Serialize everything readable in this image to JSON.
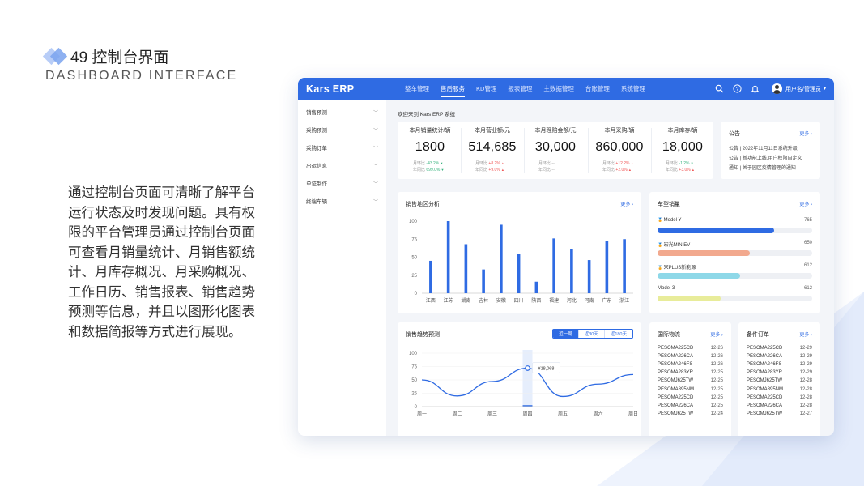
{
  "slide": {
    "title": "49 控制台界面",
    "subtitle": "DASHBOARD INTERFACE",
    "description": "通过控制台页面可清晰了解平台运行状态及时发现问题。具有权限的平台管理员通过控制台页面可查看月销量统计、月销售额统计、月库存概况、月采购概况、工作日历、销售报表、销售趋势预测等信息，并且以图形化图表和数据简报等方式进行展现。"
  },
  "app": {
    "logo": "Kars ERP",
    "nav": [
      "整车管理",
      "售后服务",
      "KD管理",
      "报表管理",
      "主数据管理",
      "台账管理",
      "系统管理"
    ],
    "nav_active": 1,
    "user": "用户名/管理员",
    "sidebar": [
      "销售预测",
      "采购预测",
      "采购订单",
      "出运信息",
      "单证制作",
      "终端车辆"
    ],
    "welcome": "欢迎来到 Kars ERP 系统",
    "stats": [
      {
        "label": "本月销量统计/辆",
        "value": "1800",
        "mom_label": "月环比",
        "mom": "-43.2%",
        "mom_dir": "down",
        "yoy_label": "年同比",
        "yoy": "699.0%",
        "yoy_dir": "down"
      },
      {
        "label": "本月营业额/元",
        "value": "514,685",
        "mom_label": "月环比",
        "mom": "+8.2%",
        "mom_dir": "up",
        "yoy_label": "年同比",
        "yoy": "+9.0%",
        "yoy_dir": "up"
      },
      {
        "label": "本月理赔金额/元",
        "value": "30,000",
        "mom_label": "月环比",
        "mom": "--",
        "mom_dir": "none",
        "yoy_label": "年同比",
        "yoy": "--",
        "yoy_dir": "none"
      },
      {
        "label": "本月采购/辆",
        "value": "860,000",
        "mom_label": "月环比",
        "mom": "+12.2%",
        "mom_dir": "up",
        "yoy_label": "年同比",
        "yoy": "+2.0%",
        "yoy_dir": "up"
      },
      {
        "label": "本月库存/辆",
        "value": "18,000",
        "mom_label": "月环比",
        "mom": "-1.2%",
        "mom_dir": "down",
        "yoy_label": "年同比",
        "yoy": "+3.0%",
        "yoy_dir": "up"
      }
    ],
    "notice": {
      "title": "公告",
      "more": "更多 ›",
      "items": [
        "公告 | 2022年11月11日系统升级",
        "公告 | 新功能上线,用户权限自定义",
        "通知 | 关于园区疫情管理的通知"
      ]
    },
    "region": {
      "title": "销售地区分析",
      "more": "更多 ›"
    },
    "models": {
      "title": "车型销量",
      "more": "更多 ›",
      "items": [
        {
          "name": "Model Y",
          "value": "765",
          "ratio": 0.755,
          "color": "#2f6be3",
          "icon": "award-icon"
        },
        {
          "name": "宏光MINIEV",
          "value": "650",
          "ratio": 0.595,
          "color": "#f2a98e",
          "icon": "award-icon"
        },
        {
          "name": "宋PLUS新能源",
          "value": "612",
          "ratio": 0.535,
          "color": "#8ed8e8",
          "icon": "award-icon"
        },
        {
          "name": "Model 3",
          "value": "612",
          "ratio": 0.41,
          "color": "#e8ec9a",
          "icon": ""
        }
      ]
    },
    "trend": {
      "title": "销售趋势预测",
      "segments": [
        "近一周",
        "近30天",
        "近180天"
      ],
      "segment_active": 0
    },
    "logistics": {
      "title": "国际物流",
      "more": "更多 ›",
      "rows": [
        [
          "PESOMA225CD",
          "12-26"
        ],
        [
          "PESOMA226CA",
          "12-26"
        ],
        [
          "PESOMA246FS",
          "12-26"
        ],
        [
          "PESOMA283YR",
          "12-25"
        ],
        [
          "PESOMJ625TW",
          "12-25"
        ],
        [
          "PESOMA895NM",
          "12-25"
        ],
        [
          "PESOMA225CD",
          "12-25"
        ],
        [
          "PESOMA226CA",
          "12-25"
        ],
        [
          "PESOMJ625TW",
          "12-24"
        ]
      ]
    },
    "orders": {
      "title": "备件订单",
      "more": "更多 ›",
      "rows": [
        [
          "PESOMA225CD",
          "12-29"
        ],
        [
          "PESOMA226CA",
          "12-29"
        ],
        [
          "PESOMA246FS",
          "12-29"
        ],
        [
          "PESOMA283YR",
          "12-29"
        ],
        [
          "PESOMJ625TW",
          "12-28"
        ],
        [
          "PESOMA895NM",
          "12-28"
        ],
        [
          "PESOMA225CD",
          "12-28"
        ],
        [
          "PESOMA226CA",
          "12-28"
        ],
        [
          "PESOMJ625TW",
          "12-27"
        ]
      ]
    }
  },
  "chart_data": [
    {
      "type": "bar",
      "title": "销售地区分析",
      "categories": [
        "江西",
        "江苏",
        "湖南",
        "吉林",
        "安徽",
        "四川",
        "陕西",
        "福建",
        "河北",
        "河南",
        "广东",
        "浙江"
      ],
      "values": [
        45,
        100,
        68,
        33,
        95,
        54,
        16,
        76,
        61,
        46,
        72,
        75
      ],
      "ylim": [
        0,
        100
      ],
      "yticks": [
        0,
        25,
        50,
        75,
        100
      ],
      "color": "#2f6be3"
    },
    {
      "type": "line",
      "title": "销售趋势预测",
      "categories": [
        "周一",
        "周二",
        "周三",
        "周四",
        "周五",
        "周六",
        "周日"
      ],
      "values": [
        50,
        20,
        47,
        72,
        19,
        42,
        60
      ],
      "ylim": [
        0,
        100
      ],
      "yticks": [
        0,
        25,
        50,
        75,
        100
      ],
      "tooltip": "¥18,068",
      "highlight_index": 3,
      "color": "#2f6be3"
    }
  ]
}
